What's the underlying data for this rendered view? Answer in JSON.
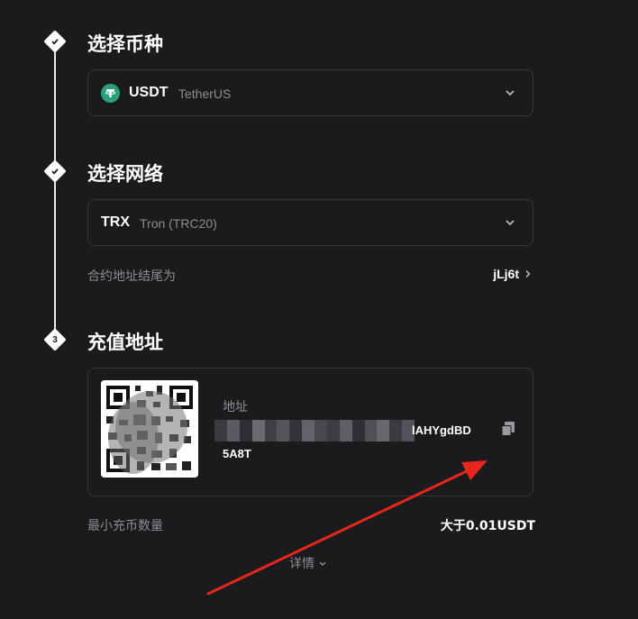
{
  "steps": [
    {
      "number": "",
      "title": "选择币种",
      "status": "done"
    },
    {
      "number": "",
      "title": "选择网络",
      "status": "done"
    },
    {
      "number": "3",
      "title": "充值地址",
      "status": "active"
    }
  ],
  "coin_select": {
    "symbol": "USDT",
    "name": "TetherUS",
    "icon": "tether-icon",
    "icon_color": "#26a17b"
  },
  "network_select": {
    "symbol": "TRX",
    "name": "Tron (TRC20)"
  },
  "contract": {
    "label": "合约地址结尾为",
    "value": "jLj6t"
  },
  "deposit": {
    "address_label": "地址",
    "address_visible_part": "lAHYgdBD",
    "address_line2": "5A8T",
    "min_label": "最小充币数量",
    "min_value": "大于0.01USDT",
    "details_label": "详情"
  },
  "colors": {
    "background": "#1b1b1e",
    "border": "#36363b",
    "muted_text": "#8c8c93",
    "annotation_arrow": "#e8261c"
  }
}
